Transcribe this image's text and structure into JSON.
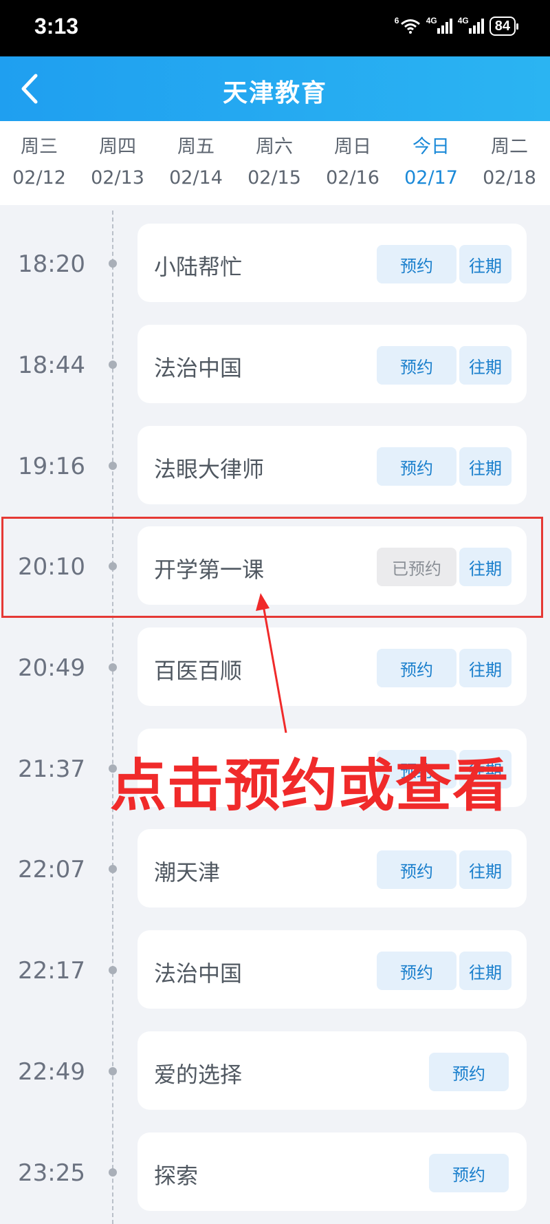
{
  "status_bar": {
    "time": "3:13",
    "wifi_badge": "6",
    "signal1_tag": "4G",
    "signal2_tag": "4G",
    "battery": "84"
  },
  "header": {
    "title": "天津教育",
    "back_icon": "chevron-left-icon"
  },
  "days": [
    {
      "weekday": "周三",
      "date": "02/12"
    },
    {
      "weekday": "周四",
      "date": "02/13"
    },
    {
      "weekday": "周五",
      "date": "02/14"
    },
    {
      "weekday": "周六",
      "date": "02/15"
    },
    {
      "weekday": "周日",
      "date": "02/16"
    },
    {
      "weekday": "今日",
      "date": "02/17"
    },
    {
      "weekday": "周二",
      "date": "02/18"
    }
  ],
  "programs": [
    {
      "time": "18:20",
      "name": "小陆帮忙",
      "book": "预约",
      "past": "往期"
    },
    {
      "time": "18:44",
      "name": "法治中国",
      "book": "预约",
      "past": "往期"
    },
    {
      "time": "19:16",
      "name": "法眼大律师",
      "book": "预约",
      "past": "往期"
    },
    {
      "time": "20:10",
      "name": "开学第一课",
      "book": "已预约",
      "past": "往期"
    },
    {
      "time": "20:49",
      "name": "百医百顺",
      "book": "预约",
      "past": "往期"
    },
    {
      "time": "21:37",
      "name": "",
      "book": "预约",
      "past": "往期"
    },
    {
      "time": "22:07",
      "name": "潮天津",
      "book": "预约",
      "past": "往期"
    },
    {
      "time": "22:17",
      "name": "法治中国",
      "book": "预约",
      "past": "往期"
    },
    {
      "time": "22:49",
      "name": "爱的选择",
      "book": "预约",
      "past": ""
    },
    {
      "time": "23:25",
      "name": "探索",
      "book": "预约",
      "past": ""
    }
  ],
  "annotation": {
    "text": "点击预约或查看",
    "color": "#f02a2a"
  },
  "colors": {
    "header": "#1f9ff0",
    "active_day": "#1a89d8",
    "button_bg": "#e4f0fb",
    "button_text": "#1a7fcc"
  }
}
